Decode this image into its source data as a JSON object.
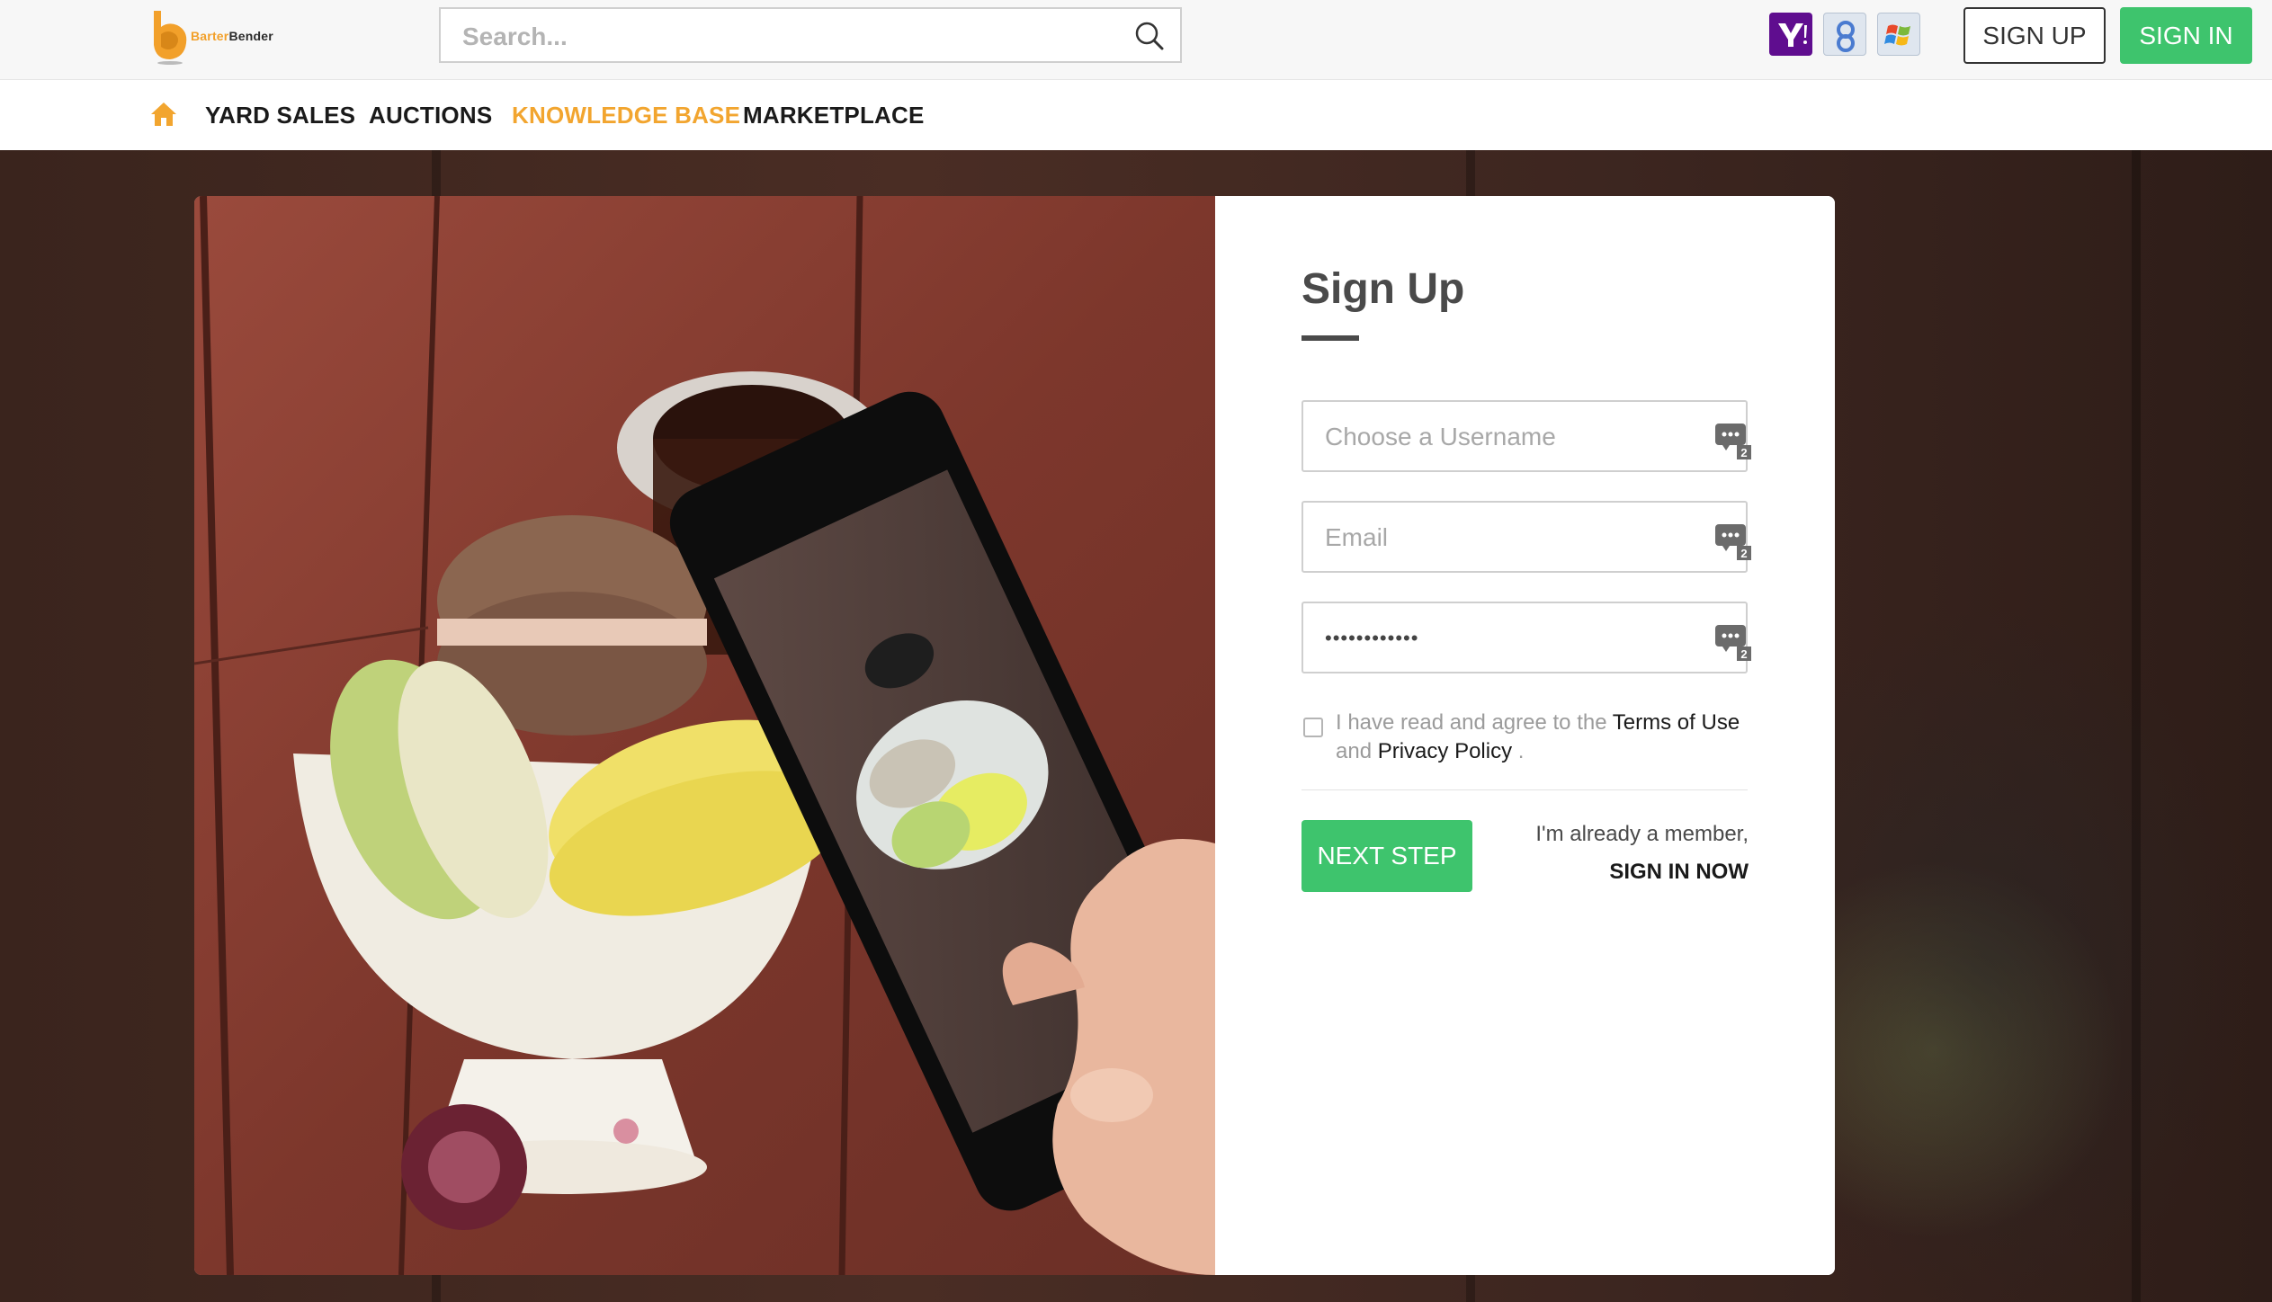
{
  "header": {
    "logo": {
      "prefix": "Barter",
      "suffix": "Bender"
    },
    "search": {
      "placeholder": "Search...",
      "value": ""
    },
    "social_logins": [
      "yahoo",
      "google",
      "windows"
    ],
    "sign_up_label": "SIGN UP",
    "sign_in_label": "SIGN IN"
  },
  "nav": {
    "items": [
      {
        "label": "YARD SALES",
        "active": false
      },
      {
        "label": "AUCTIONS",
        "active": false
      },
      {
        "label": "KNOWLEDGE BASE",
        "active": true
      },
      {
        "label": "MARKETPLACE",
        "active": false
      }
    ]
  },
  "form": {
    "title": "Sign Up",
    "username": {
      "placeholder": "Choose a Username",
      "value": ""
    },
    "email": {
      "placeholder": "Email",
      "value": ""
    },
    "password": {
      "value": "••••••••••••"
    },
    "field_badge": "2",
    "agree": {
      "checked": false,
      "text_before": "I have read and agree to the ",
      "terms_label": "Terms of Use",
      "text_middle": " and ",
      "privacy_label": "Privacy Policy",
      "text_after": " ."
    },
    "next_step_label": "NEXT STEP",
    "member_text": "I'm already a member,",
    "sign_in_now_label": "SIGN IN NOW"
  },
  "colors": {
    "accent_green": "#3ec46d",
    "active_nav": "#f2a52f",
    "brand_orange": "#f2a02a"
  }
}
